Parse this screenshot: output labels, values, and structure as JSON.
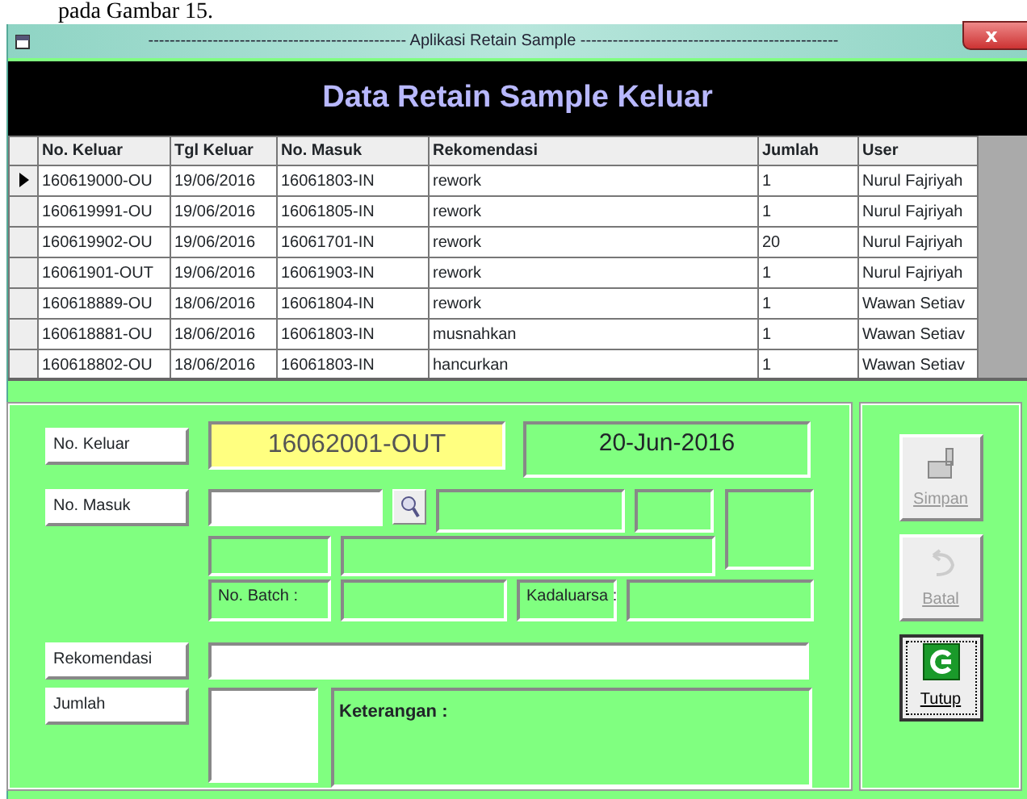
{
  "caption": "pada Gambar 15.",
  "window": {
    "title": "------------------------------------------------ Aplikasi Retain Sample ------------------------------------------------",
    "close": "x"
  },
  "header": "Data Retain Sample Keluar",
  "table": {
    "columns": [
      "No. Keluar",
      "Tgl Keluar",
      "No. Masuk",
      "Rekomendasi",
      "Jumlah",
      "User"
    ],
    "rows": [
      {
        "selected": true,
        "cells": [
          "160619000-OU",
          "19/06/2016",
          "16061803-IN",
          "rework",
          "1",
          "Nurul Fajriyah"
        ]
      },
      {
        "selected": false,
        "cells": [
          "160619991-OU",
          "19/06/2016",
          "16061805-IN",
          "rework",
          "1",
          "Nurul Fajriyah"
        ]
      },
      {
        "selected": false,
        "cells": [
          "160619902-OU",
          "19/06/2016",
          "16061701-IN",
          "rework",
          "20",
          "Nurul Fajriyah"
        ]
      },
      {
        "selected": false,
        "cells": [
          "16061901-OUT",
          "19/06/2016",
          "16061903-IN",
          "rework",
          "1",
          "Nurul Fajriyah"
        ]
      },
      {
        "selected": false,
        "cells": [
          "160618889-OU",
          "18/06/2016",
          "16061804-IN",
          "rework",
          "1",
          "Wawan Setiav"
        ]
      },
      {
        "selected": false,
        "cells": [
          "160618881-OU",
          "18/06/2016",
          "16061803-IN",
          "musnahkan",
          "1",
          "Wawan Setiav"
        ]
      },
      {
        "selected": false,
        "cells": [
          "160618802-OU",
          "18/06/2016",
          "16061803-IN",
          "hancurkan",
          "1",
          "Wawan Setiav"
        ]
      }
    ]
  },
  "form": {
    "no_keluar": {
      "label": "No. Keluar",
      "value": "16062001-OUT"
    },
    "date": "20-Jun-2016",
    "no_masuk": {
      "label": "No. Masuk"
    },
    "no_batch_label": "No. Batch :",
    "kadaluarsa_label": "Kadaluarsa :",
    "rekomendasi": {
      "label": "Rekomendasi"
    },
    "jumlah": {
      "label": "Jumlah"
    },
    "keterangan_label": "Keterangan :"
  },
  "buttons": [
    {
      "kind": "save",
      "label": "Simpan",
      "disabled": true
    },
    {
      "kind": "cancel",
      "label": "Batal",
      "disabled": true
    },
    {
      "kind": "close",
      "label": "Tutup",
      "disabled": false
    }
  ]
}
